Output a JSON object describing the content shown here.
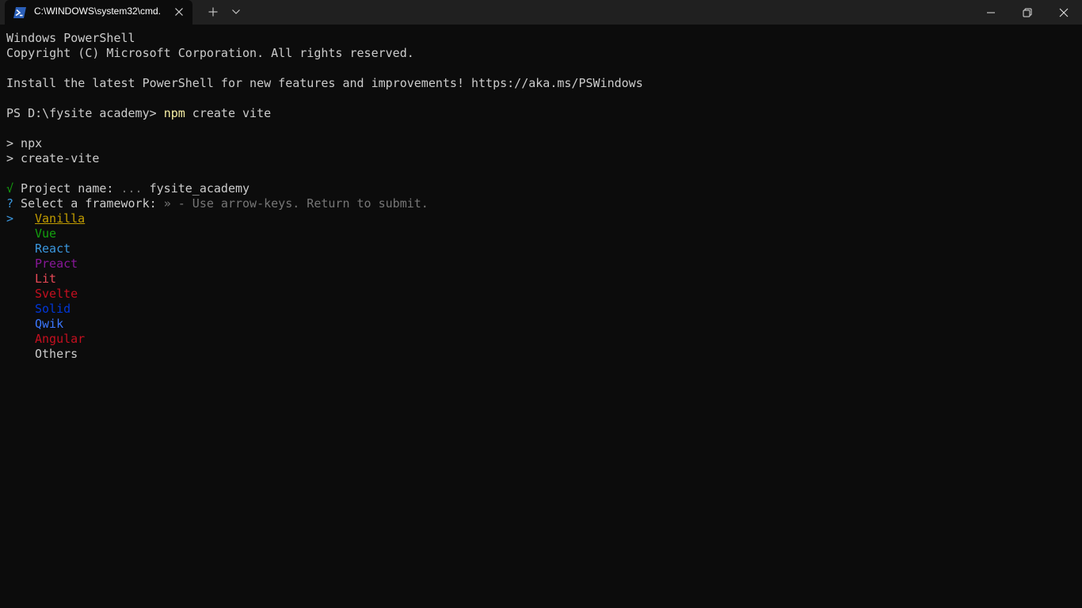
{
  "window": {
    "tab_title": "C:\\WINDOWS\\system32\\cmd.",
    "tab_icon": "powershell-icon",
    "buttons": [
      "close-tab-icon",
      "new-tab-icon",
      "tab-dropdown-icon",
      "minimize-icon",
      "maximize-icon",
      "close-window-icon"
    ]
  },
  "terminal": {
    "header_line1": "Windows PowerShell",
    "header_line2": "Copyright (C) Microsoft Corporation. All rights reserved.",
    "install_line": "Install the latest PowerShell for new features and improvements! https://aka.ms/PSWindows",
    "prompt": "PS D:\\fysite academy> ",
    "command_name": "npm",
    "command_args": " create vite",
    "npx_line": "> npx",
    "create_vite_line": "> create-vite",
    "project_check": "√",
    "project_label": " Project name: ",
    "project_dots": "...",
    "project_value": " fysite_academy",
    "select_q": "?",
    "select_label": " Select a framework: ",
    "select_hint": "» - Use arrow-keys. Return to submit.",
    "pointer": ">",
    "frameworks": [
      "Vanilla",
      "Vue",
      "React",
      "Preact",
      "Lit",
      "Svelte",
      "Solid",
      "Qwik",
      "Angular",
      "Others"
    ],
    "selected_framework": "Vanilla"
  },
  "colors": {
    "background": "#0c0c0c",
    "titlebar": "#202020",
    "foreground": "#cccccc"
  }
}
